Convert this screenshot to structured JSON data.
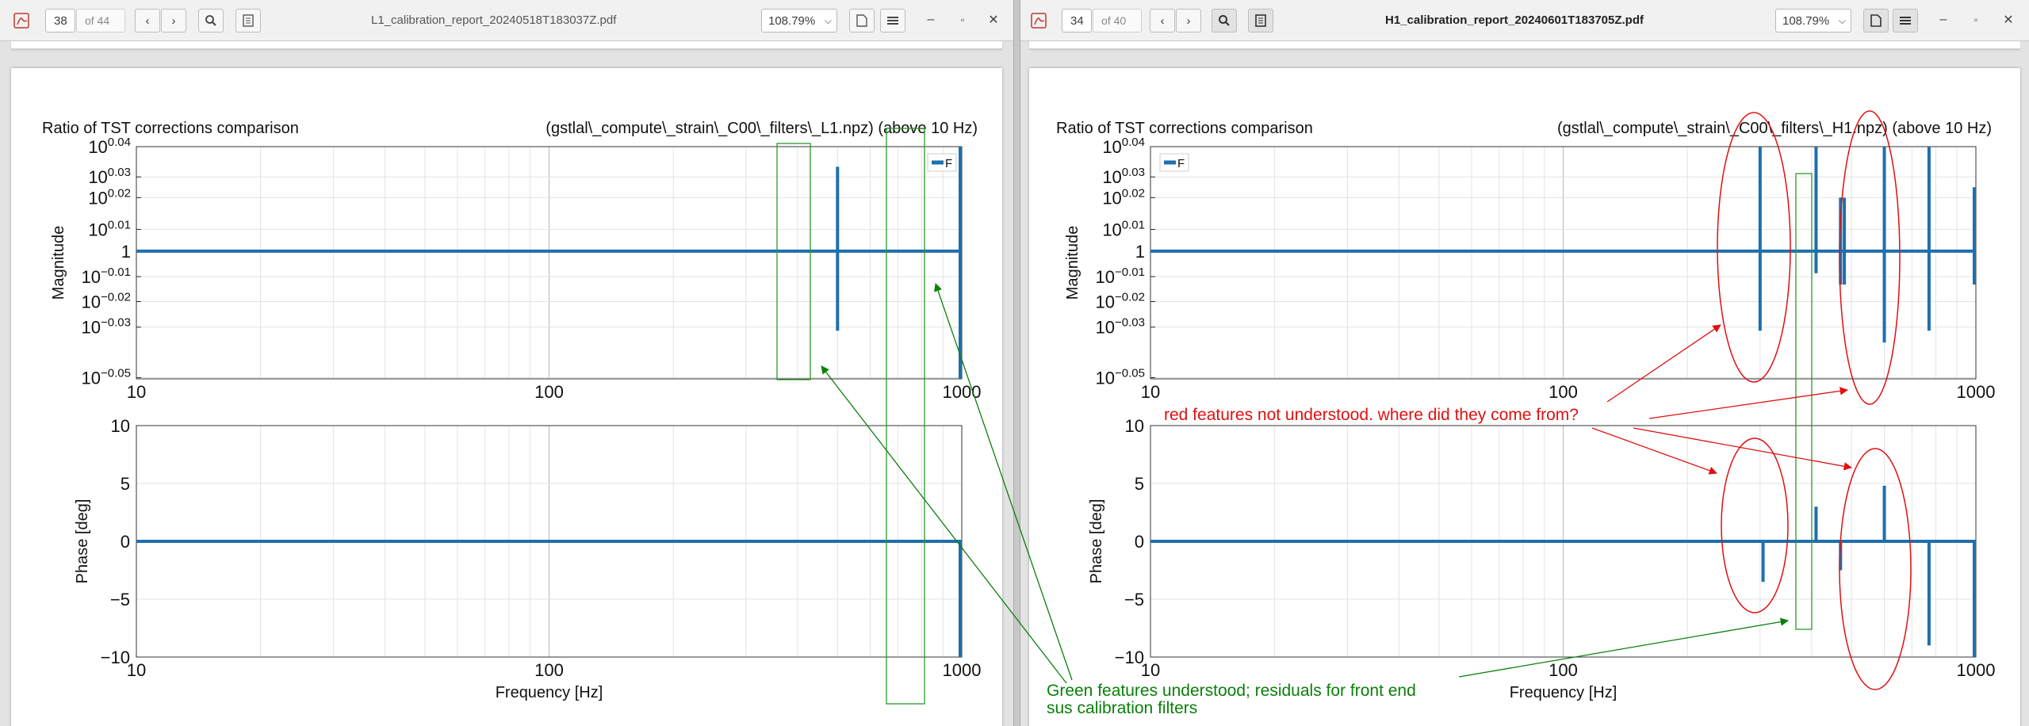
{
  "left": {
    "page_number": "38",
    "page_of": "of 44",
    "filename": "L1_calibration_report_20240518T183037Z.pdf",
    "zoom": "108.79%",
    "plot_title_left": "Ratio of TST corrections comparison",
    "plot_title_right": "(gstlal\\_compute\\_strain\\_C00\\_filters\\_L1.npz) (above 10 Hz)",
    "legend_label": "F"
  },
  "right": {
    "page_number": "34",
    "page_of": "of 40",
    "filename": "H1_calibration_report_20240601T183705Z.pdf",
    "zoom": "108.79%",
    "plot_title_left": "Ratio of TST corrections comparison",
    "plot_title_right": "(gstlal\\_compute\\_strain\\_C00\\_filters\\_H1.npz) (above 10 Hz)",
    "legend_label": "F"
  },
  "axes": {
    "magnitude_label": "Magnitude",
    "phase_label": "Phase [deg]",
    "frequency_label": "Frequency [Hz]",
    "x_ticks": [
      "10",
      "100",
      "1000"
    ],
    "mag_ticks": [
      {
        "base": "10",
        "exp": "0.04"
      },
      {
        "base": "10",
        "exp": "0.03"
      },
      {
        "base": "10",
        "exp": "0.02"
      },
      {
        "base": "10",
        "exp": "0.01"
      },
      {
        "base": "1",
        "exp": ""
      },
      {
        "base": "10",
        "exp": "−0.01"
      },
      {
        "base": "10",
        "exp": "−0.02"
      },
      {
        "base": "10",
        "exp": "−0.03"
      },
      {
        "base": "10",
        "exp": "−0.05"
      }
    ],
    "phase_ticks": [
      "10",
      "5",
      "0",
      "−5",
      "−10"
    ]
  },
  "annotations": {
    "red_text": "red features not understood. where did they come from?",
    "green_text_line1": "Green features understood; residuals for front end",
    "green_text_line2": "sus calibration filters"
  },
  "colors": {
    "trace": "#1f6fad",
    "annotation_red": "#e01010",
    "annotation_green": "#0a800a"
  },
  "chart_data": [
    {
      "type": "line",
      "panel": "L1 magnitude",
      "x_scale": "log",
      "xlim": [
        10,
        1000
      ],
      "y_scale": "log",
      "series": [
        {
          "name": "F",
          "x": [
            10,
            500,
            500,
            500,
            1000,
            1000,
            1000
          ],
          "y": [
            1.0,
            1.0,
            1.08,
            0.93,
            1.0,
            1.1,
            0.89
          ]
        }
      ]
    },
    {
      "type": "line",
      "panel": "L1 phase",
      "x_scale": "log",
      "xlim": [
        10,
        1000
      ],
      "ylim": [
        -10,
        10
      ],
      "series": [
        {
          "x": [
            10,
            1000,
            1000
          ],
          "y": [
            0,
            0,
            -10
          ]
        }
      ]
    },
    {
      "type": "line",
      "panel": "H1 magnitude",
      "x_scale": "log",
      "xlim": [
        10,
        1000
      ],
      "y_scale": "log",
      "series": [
        {
          "name": "F",
          "x": [
            10,
            300,
            300,
            410,
            410,
            470,
            470,
            480,
            480,
            600,
            600,
            770,
            770,
            1000,
            1000
          ],
          "y": [
            1.0,
            1.1,
            0.93,
            1.1,
            0.98,
            1.05,
            0.97,
            1.05,
            0.97,
            1.1,
            0.92,
            1.1,
            0.93,
            1.06,
            0.97
          ]
        }
      ]
    },
    {
      "type": "line",
      "panel": "H1 phase",
      "x_scale": "log",
      "xlim": [
        10,
        1000
      ],
      "ylim": [
        -10,
        10
      ],
      "series": [
        {
          "x": [
            10,
            305,
            410,
            470,
            600,
            770,
            1000
          ],
          "y": [
            0,
            -3.5,
            3,
            -2.5,
            4.8,
            -9,
            -10
          ]
        }
      ]
    }
  ]
}
